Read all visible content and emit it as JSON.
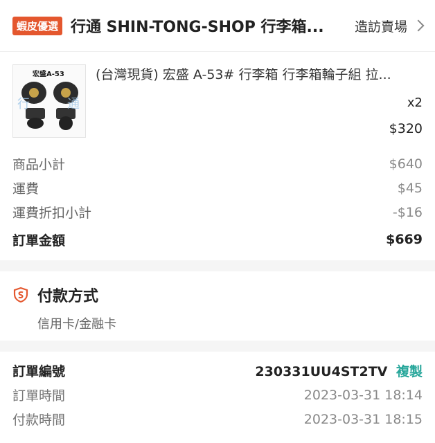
{
  "shop": {
    "badge": "蝦皮優選",
    "name": "行通 SHIN-TONG-SHOP 行李箱...",
    "visit_label": "造訪賣場"
  },
  "product": {
    "thumb_text": "宏盛A-53",
    "title": "(台灣現貨) 宏盛 A-53# 行李箱 行李箱輪子組 拉...",
    "quantity": "x2",
    "price": "$320"
  },
  "summary": {
    "subtotal_label": "商品小計",
    "subtotal_value": "$640",
    "shipping_label": "運費",
    "shipping_value": "$45",
    "discount_label": "運費折扣小計",
    "discount_value": "-$16",
    "total_label": "訂單金額",
    "total_value": "$669"
  },
  "payment": {
    "heading": "付款方式",
    "method": "信用卡/金融卡"
  },
  "order": {
    "id_label": "訂單編號",
    "id_value": "230331UU4ST2TV",
    "copy_label": "複製",
    "order_time_label": "訂單時間",
    "order_time_value": "2023-03-31 18:14",
    "pay_time_label": "付款時間",
    "pay_time_value": "2023-03-31 18:15"
  },
  "colors": {
    "accent": "#e4572e",
    "copy": "#26a69a"
  },
  "icons": {
    "shield": "shield-s-icon",
    "chevron": "chevron-right-icon"
  }
}
